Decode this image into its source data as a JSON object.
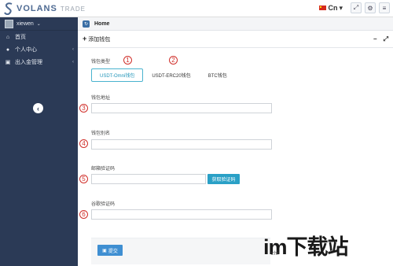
{
  "topbar": {
    "brand": "VOLANS",
    "brand_sub": "TRADE",
    "language": "Cn"
  },
  "sidebar": {
    "user_name": "xiewen",
    "items": [
      {
        "label": "首页",
        "icon": "home-icon",
        "has_children": false
      },
      {
        "label": "个人中心",
        "icon": "user-icon",
        "has_children": true
      },
      {
        "label": "出入金管理",
        "icon": "money-icon",
        "has_children": true
      }
    ]
  },
  "breadcrumb": {
    "home": "Home"
  },
  "panel": {
    "title": "添加钱包"
  },
  "form": {
    "wallet_type_label": "钱包类型",
    "wallet_types": [
      "USDT-Omni钱包",
      "USDT-ERC20钱包",
      "BTC钱包"
    ],
    "selected_wallet_type": "USDT-Omni钱包",
    "address_label": "钱包地址",
    "address_value": "",
    "alias_label": "钱包别名",
    "alias_value": "",
    "email_code_label": "邮箱验证码",
    "email_code_value": "",
    "get_code_button": "获取验证码",
    "google_code_label": "谷歌验证码",
    "google_code_value": "",
    "submit_button": "提交"
  },
  "annotations": [
    "1",
    "2",
    "3",
    "4",
    "5",
    "6"
  ],
  "watermark": {
    "text": "im下载站",
    "sub": "zhi"
  },
  "colors": {
    "sidebar_bg": "#2b3a56",
    "accent": "#2aa0c6",
    "submit": "#3f8fd2",
    "marker": "#d0302b"
  }
}
